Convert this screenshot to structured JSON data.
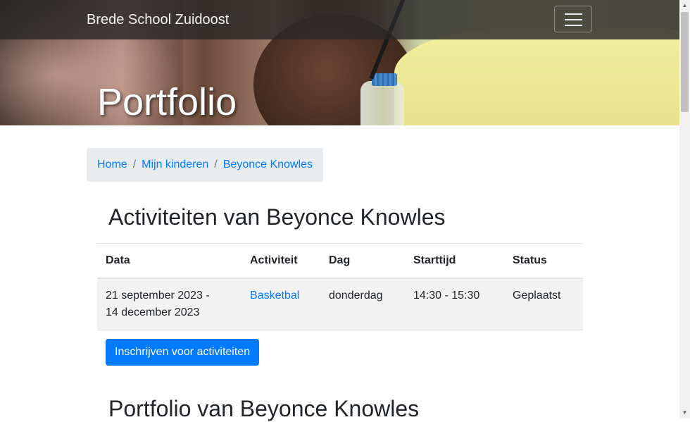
{
  "navbar": {
    "brand": "Brede School Zuidoost",
    "toggle_icon": "hamburger-menu-icon"
  },
  "hero": {
    "title": "Portfolio"
  },
  "breadcrumb": {
    "items": [
      "Home",
      "Mijn kinderen",
      "Beyonce Knowles"
    ],
    "separator": "/"
  },
  "activities": {
    "title": "Activiteiten van Beyonce Knowles",
    "columns": [
      "Data",
      "Activiteit",
      "Dag",
      "Starttijd",
      "Status"
    ],
    "rows": [
      {
        "data_line1": "21 september 2023 -",
        "data_line2": "14 december 2023",
        "activiteit": "Basketbal",
        "dag": "donderdag",
        "starttijd": "14:30 - 15:30",
        "status": "Geplaatst"
      }
    ],
    "button_label": "Inschrijven voor activiteiten"
  },
  "portfolio": {
    "title": "Portfolio van Beyonce Knowles"
  },
  "colors": {
    "primary": "#007bff",
    "navbar_bg": "#2b2b2b",
    "breadcrumb_bg": "#e9ecef"
  }
}
